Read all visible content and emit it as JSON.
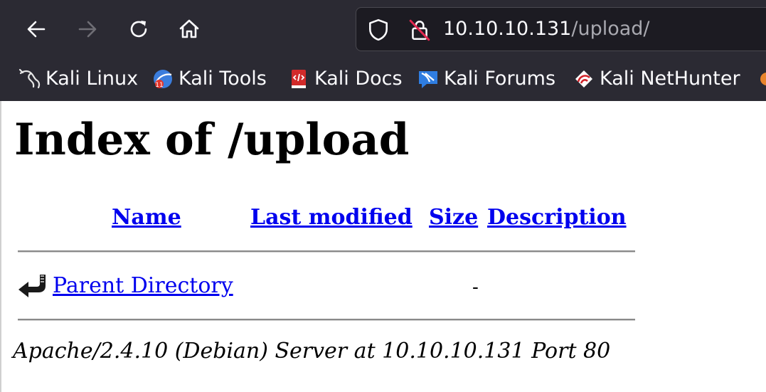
{
  "browser": {
    "url_host": "10.10.10.131",
    "url_path": "/upload/",
    "icons": {
      "back": "arrow-left-icon",
      "forward": "arrow-right-icon",
      "reload": "reload-icon",
      "home": "home-icon",
      "tracking": "shield-icon",
      "insecure": "lock-slashed-icon"
    },
    "forward_enabled": false,
    "colors": {
      "chrome_bg": "#2b2a33",
      "urlbar_bg": "#1c1b22",
      "insecure_slash": "#e22850",
      "text": "#fbfbfe",
      "path_text": "#a9a9b0"
    }
  },
  "bookmarks": [
    {
      "label": "Kali Linux",
      "icon": "kali-dragon-icon"
    },
    {
      "label": "Kali Tools",
      "icon": "kali-tools-icon"
    },
    {
      "label": "Kali Docs",
      "icon": "kali-docs-icon"
    },
    {
      "label": "Kali Forums",
      "icon": "kali-forums-icon"
    },
    {
      "label": "Kali NetHunter",
      "icon": "kali-nethunter-icon"
    }
  ],
  "page": {
    "title": "Index of /upload",
    "columns": {
      "name": "Name",
      "last_modified": "Last modified",
      "size": "Size",
      "description": "Description"
    },
    "rows": [
      {
        "icon": "back-folder-icon",
        "name": "Parent Directory",
        "last_modified": "",
        "size": "-",
        "description": ""
      }
    ],
    "address": "Apache/2.4.10 (Debian) Server at 10.10.10.131 Port 80",
    "link_color": "#0000ee"
  }
}
